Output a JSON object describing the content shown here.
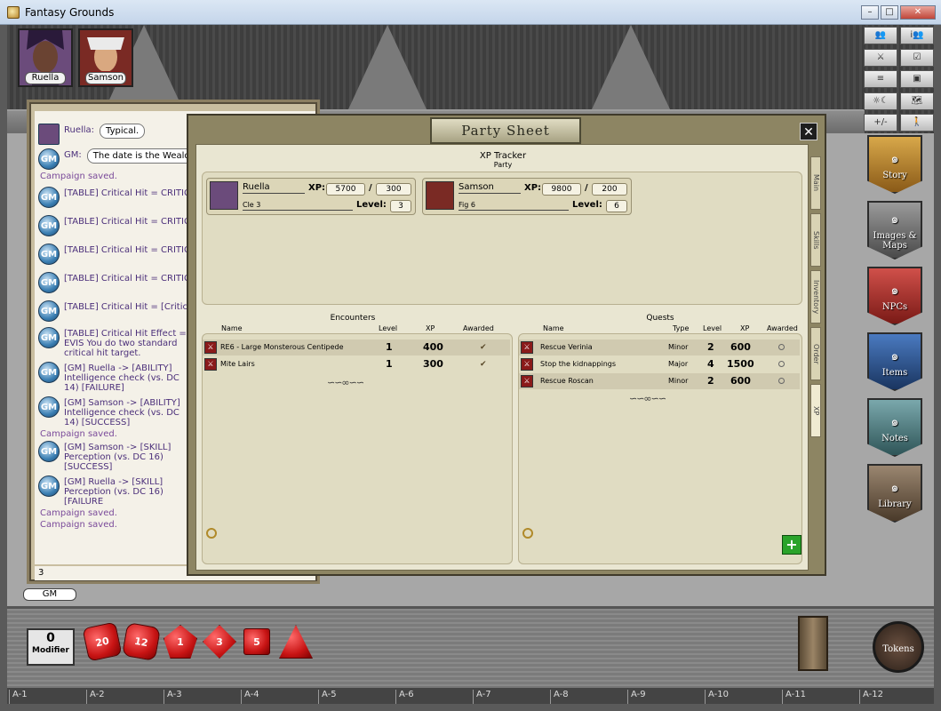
{
  "window": {
    "title": "Fantasy Grounds",
    "min": "–",
    "max": "□",
    "close": "✕"
  },
  "portraits": [
    {
      "name": "Ruella",
      "color": "#6b4b7b"
    },
    {
      "name": "Samson",
      "color": "#7a2a24"
    }
  ],
  "chat": {
    "messages": [
      {
        "type": "player",
        "speaker": "Ruella:",
        "text": "Typical."
      },
      {
        "type": "gm",
        "speaker": "GM:",
        "text": "The date is the Wealda"
      },
      {
        "type": "sys",
        "text": "Campaign saved."
      },
      {
        "type": "gm",
        "text": "[TABLE] Critical Hit = CRITICAL H"
      },
      {
        "type": "gm",
        "text": "[TABLE] Critical Hit = CRITICAL H"
      },
      {
        "type": "gm",
        "text": "[TABLE] Critical Hit = CRITICAL H"
      },
      {
        "type": "gm",
        "text": "[TABLE] Critical Hit = CRITICAL H"
      },
      {
        "type": "gm",
        "text": "[TABLE] Critical Hit = [Critical Hit"
      },
      {
        "type": "gm",
        "text": "[TABLE] Critical Hit Effect = EVIS You do two standard critical hit target."
      },
      {
        "type": "gm",
        "text": "[GM] Ruella -> [ABILITY] Intelligence check (vs. DC 14) [FAILURE]"
      },
      {
        "type": "gm",
        "text": "[GM] Samson -> [ABILITY] Intelligence check (vs. DC 14) [SUCCESS]"
      },
      {
        "type": "sys",
        "text": "Campaign saved."
      },
      {
        "type": "gm",
        "text": "[GM] Samson -> [SKILL] Perception (vs. DC 16) [SUCCESS]"
      },
      {
        "type": "gm",
        "text": "[GM] Ruella -> [SKILL] Perception (vs. DC 16) [FAILURE"
      },
      {
        "type": "sys",
        "text": "Campaign saved."
      },
      {
        "type": "sys",
        "text": "Campaign saved."
      }
    ],
    "input_value": "3",
    "identity": "GM"
  },
  "toolbar": [
    "👥",
    "i👥",
    "⚔",
    "☑",
    "≡",
    "▣",
    "☼☾",
    "🗺",
    "+/-",
    "🚶"
  ],
  "sidebar": [
    {
      "label": "Story",
      "color": "#b8862a"
    },
    {
      "label": "Images & Maps",
      "color": "#6b6b6b"
    },
    {
      "label": "NPCs",
      "color": "#a8352c"
    },
    {
      "label": "Items",
      "color": "#2c4f8a"
    },
    {
      "label": "Notes",
      "color": "#4f7a80"
    },
    {
      "label": "Library",
      "color": "#6a5a48"
    }
  ],
  "party_sheet": {
    "title": "Party Sheet",
    "close": "✕",
    "xp_tracker_title": "XP Tracker",
    "xp_tracker_sub": "Party",
    "members": [
      {
        "name": "Ruella",
        "class": "Cle 3",
        "xp": "5700",
        "xp_next": "300",
        "level": "3",
        "xp_label": "XP:",
        "level_label": "Level:",
        "slash": "/"
      },
      {
        "name": "Samson",
        "class": "Fig 6",
        "xp": "9800",
        "xp_next": "200",
        "level": "6",
        "xp_label": "XP:",
        "level_label": "Level:",
        "slash": "/"
      }
    ],
    "encounters": {
      "title": "Encounters",
      "headers": {
        "name": "Name",
        "level": "Level",
        "xp": "XP",
        "awarded": "Awarded"
      },
      "rows": [
        {
          "name": "RE6 - Large Monsterous Centipede",
          "level": "1",
          "xp": "400",
          "awarded": true
        },
        {
          "name": "Mite Lairs",
          "level": "1",
          "xp": "300",
          "awarded": true
        }
      ]
    },
    "quests": {
      "title": "Quests",
      "headers": {
        "name": "Name",
        "type": "Type",
        "level": "Level",
        "xp": "XP",
        "awarded": "Awarded"
      },
      "rows": [
        {
          "name": "Rescue Verinia",
          "type": "Minor",
          "level": "2",
          "xp": "600",
          "awarded": false
        },
        {
          "name": "Stop the kidnappings",
          "type": "Major",
          "level": "4",
          "xp": "1500",
          "awarded": false
        },
        {
          "name": "Rescue Roscan",
          "type": "Minor",
          "level": "2",
          "xp": "600",
          "awarded": false
        }
      ]
    },
    "tabs": [
      "Main",
      "Skills",
      "Inventory",
      "Order",
      "XP"
    ],
    "add_label": "+"
  },
  "dice": {
    "modifier_value": "0",
    "modifier_label": "Modifier",
    "dice": [
      "d20",
      "d12",
      "d10",
      "d8",
      "d6",
      "d4"
    ],
    "die_faces": [
      "20",
      "12",
      "1",
      "3",
      "5",
      ""
    ]
  },
  "tokens_label": "Tokens",
  "grid_labels": [
    "A-1",
    "A-2",
    "A-3",
    "A-4",
    "A-5",
    "A-6",
    "A-7",
    "A-8",
    "A-9",
    "A-10",
    "A-11",
    "A-12"
  ]
}
